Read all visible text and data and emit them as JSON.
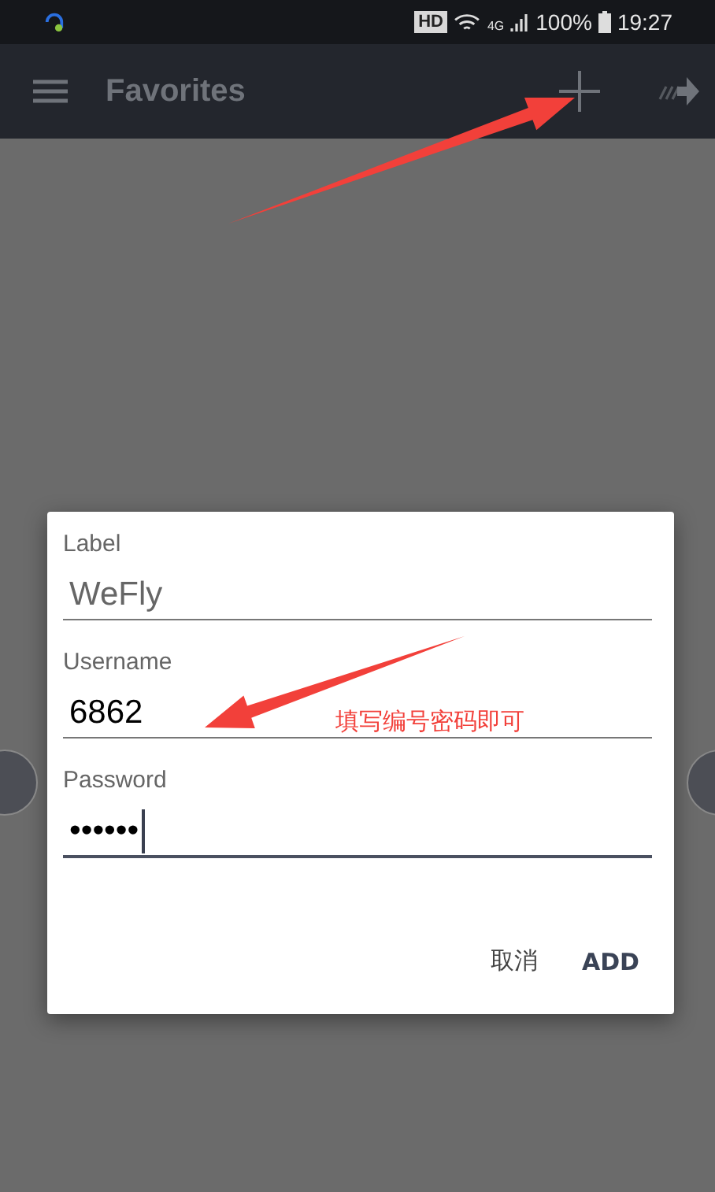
{
  "status_bar": {
    "hd": "HD",
    "network": "4G",
    "battery": "100%",
    "time": "19:27"
  },
  "app_bar": {
    "title": "Favorites"
  },
  "dialog": {
    "fields": [
      {
        "label": "Label",
        "value": "WeFly",
        "focused": false
      },
      {
        "label": "Username",
        "value": "6862",
        "focused": false
      },
      {
        "label": "Password",
        "value": "••••••",
        "focused": true
      }
    ],
    "buttons": [
      {
        "label": "取消",
        "kind": "cancel"
      },
      {
        "label": "ADD",
        "kind": "confirm"
      }
    ]
  },
  "annotation": {
    "text": "填写编号密码即可"
  }
}
